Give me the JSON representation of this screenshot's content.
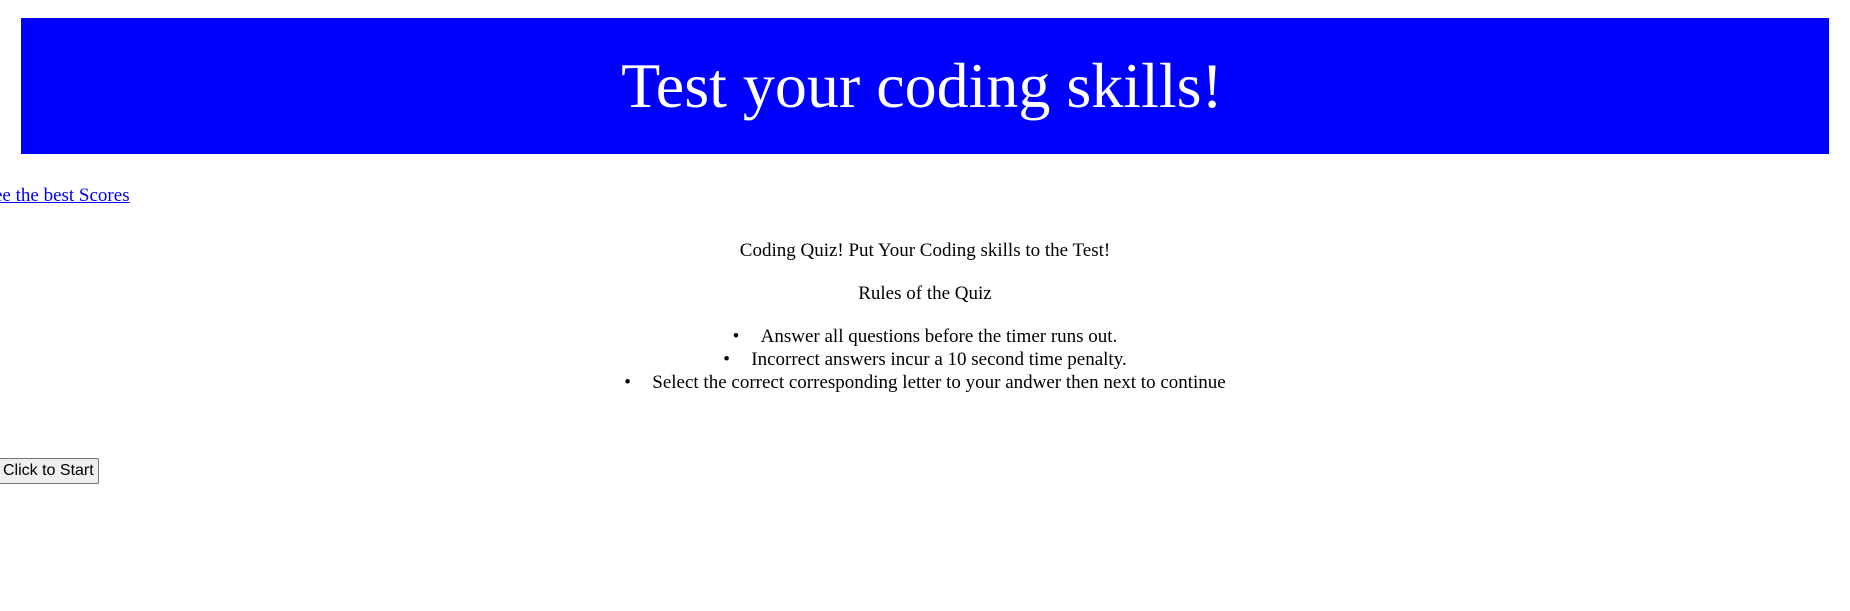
{
  "header": {
    "title": "Test your coding skills!"
  },
  "nav": {
    "scores_link": "ee the best Scores"
  },
  "intro": {
    "title": "Coding Quiz! Put Your Coding skills to the Test!",
    "rules_title": "Rules of the Quiz",
    "rules": [
      "Answer all questions before the timer runs out.",
      "Incorrect answers incur a 10 second time penalty.",
      "Select the correct corresponding letter to your andwer then next to continue"
    ]
  },
  "controls": {
    "start_label": "Click to Start"
  },
  "colors": {
    "banner": "#0000ff",
    "banner_text": "#ffffff",
    "link": "#0000ee"
  }
}
